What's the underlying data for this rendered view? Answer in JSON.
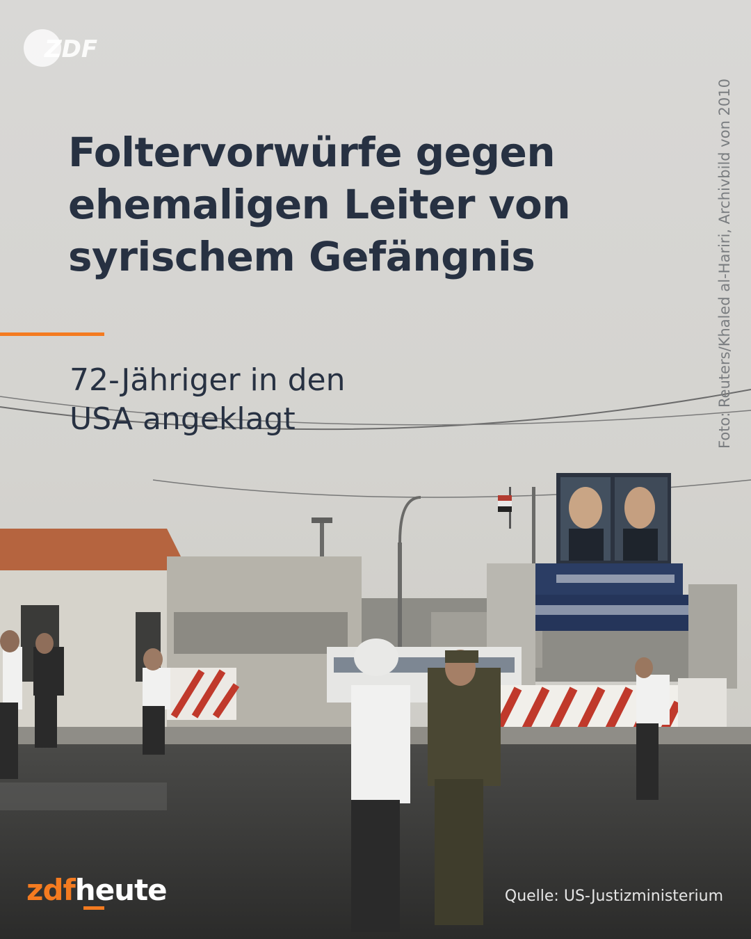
{
  "logo": {
    "text": "ZDF",
    "icon": "zdf-logo-icon"
  },
  "headline": "Foltervorwürfe gegen\nehemaligen Leiter von\nsyrischem Gefängnis",
  "subline": "72-Jähriger in den\nUSA angeklagt",
  "photo_credit": "Foto: Reuters/Khaled al-Hariri, Archivbild von 2010",
  "brand": {
    "part1": "zdf",
    "part2": "heute"
  },
  "source": "Quelle: US-Justizministerium",
  "colors": {
    "accent": "#f47b20",
    "headline": "#273142",
    "sky": "#dcdbd9"
  }
}
